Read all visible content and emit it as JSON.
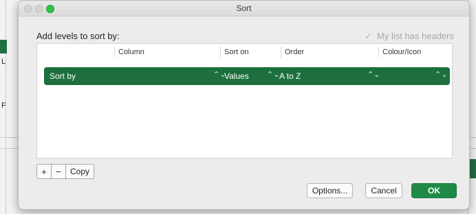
{
  "window": {
    "title": "Sort"
  },
  "dialog": {
    "prompt": "Add levels to sort by:",
    "headers_checkbox": {
      "label": "My list has headers",
      "checked": true
    }
  },
  "table": {
    "headers": [
      "Column",
      "Sort on",
      "Order",
      "Colour/Icon"
    ],
    "row": {
      "label": "Sort by",
      "column": "",
      "sort_on": "Values",
      "order": "A to Z",
      "colour_icon": ""
    }
  },
  "controls": {
    "add": "+",
    "remove": "−",
    "copy": "Copy"
  },
  "buttons": {
    "options": "Options...",
    "cancel": "Cancel",
    "ok": "OK"
  },
  "background_fragments": {
    "left_letter_1": "L",
    "left_letter_2": "F"
  },
  "colors": {
    "accent": "#1d6f3d",
    "ok": "#1f8a45",
    "window": "#ececec"
  }
}
